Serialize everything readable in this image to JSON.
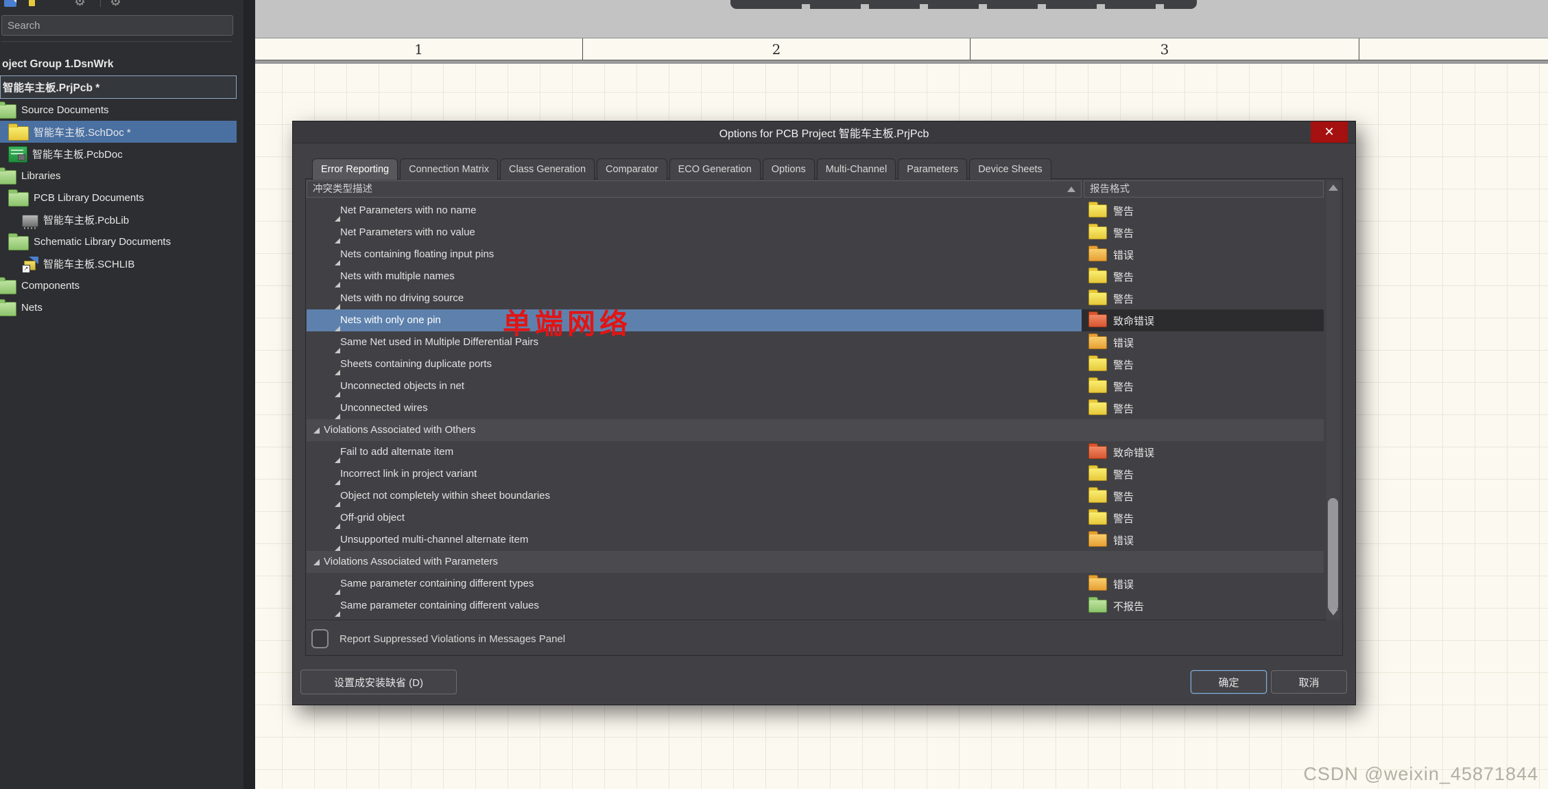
{
  "watermark": "CSDN @weixin_45871844",
  "annotation": {
    "text": "单端网络",
    "color": "#e01515"
  },
  "ruler": {
    "labels": [
      "1",
      "2",
      "3",
      ""
    ]
  },
  "sidebar": {
    "search_placeholder": "Search",
    "tree": [
      {
        "label": "oject Group 1.DsnWrk",
        "indent": 0,
        "flags": [
          "bold"
        ]
      },
      {
        "label": "智能车主板.PrjPcb *",
        "indent": 0,
        "flags": [
          "bold",
          "focused"
        ]
      },
      {
        "label": "Source Documents",
        "icon": "folder-green",
        "indent": 1
      },
      {
        "label": "智能车主板.SchDoc *",
        "icon": "folder-yellow",
        "indent": 2,
        "flags": [
          "selected"
        ]
      },
      {
        "label": "智能车主板.PcbDoc",
        "icon": "pcb-doc",
        "indent": 2
      },
      {
        "label": "Libraries",
        "icon": "folder-green",
        "indent": 1
      },
      {
        "label": "PCB Library Documents",
        "icon": "folder-green",
        "indent": 2
      },
      {
        "label": "智能车主板.PcbLib",
        "icon": "pcb-lib",
        "indent": 3
      },
      {
        "label": "Schematic Library Documents",
        "icon": "folder-green",
        "indent": 2
      },
      {
        "label": "智能车主板.SCHLIB",
        "icon": "sch-lib",
        "indent": 3
      },
      {
        "label": "Components",
        "icon": "folder-green",
        "indent": 1
      },
      {
        "label": "Nets",
        "icon": "folder-green",
        "indent": 1
      }
    ]
  },
  "dialog": {
    "title": "Options for PCB Project 智能车主板.PrjPcb",
    "close_glyph": "✕",
    "tabs": [
      {
        "label": "Error Reporting",
        "flags": [
          "active"
        ]
      },
      {
        "label": "Connection Matrix"
      },
      {
        "label": "Class Generation"
      },
      {
        "label": "Comparator"
      },
      {
        "label": "ECO Generation"
      },
      {
        "label": "Options"
      },
      {
        "label": "Multi-Channel"
      },
      {
        "label": "Parameters"
      },
      {
        "label": "Device Sheets"
      }
    ],
    "grid": {
      "headers": {
        "description": "冲突类型描述",
        "report_mode": "报告格式"
      },
      "severity_colors": {
        "warning": "#e7c83a",
        "error": "#e89f33",
        "fatal": "#d85531",
        "none": "#8cc46c"
      },
      "rows": [
        {
          "label": "Net Parameters with no name",
          "report": "警告",
          "sev": "warning"
        },
        {
          "label": "Net Parameters with no value",
          "report": "警告",
          "sev": "warning"
        },
        {
          "label": "Nets containing floating input pins",
          "report": "错误",
          "sev": "error"
        },
        {
          "label": "Nets with multiple names",
          "report": "警告",
          "sev": "warning"
        },
        {
          "label": "Nets with no driving source",
          "report": "警告",
          "sev": "warning"
        },
        {
          "label": "Nets with only one pin",
          "report": "致命错误",
          "sev": "fatal",
          "flags": [
            "selected"
          ]
        },
        {
          "label": "Same Net used in Multiple Differential Pairs",
          "report": "错误",
          "sev": "error"
        },
        {
          "label": "Sheets containing duplicate ports",
          "report": "警告",
          "sev": "warning"
        },
        {
          "label": "Unconnected objects in net",
          "report": "警告",
          "sev": "warning"
        },
        {
          "label": "Unconnected wires",
          "report": "警告",
          "sev": "warning"
        },
        {
          "label": "Violations Associated with Others",
          "flags": [
            "group"
          ]
        },
        {
          "label": "Fail to add alternate item",
          "report": "致命错误",
          "sev": "fatal"
        },
        {
          "label": "Incorrect link in project variant",
          "report": "警告",
          "sev": "warning"
        },
        {
          "label": "Object not completely within sheet boundaries",
          "report": "警告",
          "sev": "warning"
        },
        {
          "label": "Off-grid object",
          "report": "警告",
          "sev": "warning"
        },
        {
          "label": "Unsupported multi-channel alternate item",
          "report": "错误",
          "sev": "error"
        },
        {
          "label": "Violations Associated with Parameters",
          "flags": [
            "group"
          ]
        },
        {
          "label": "Same parameter containing different types",
          "report": "错误",
          "sev": "error"
        },
        {
          "label": "Same parameter containing different values",
          "report": "不报告",
          "sev": "none"
        }
      ]
    },
    "suppress_checkbox": {
      "label": "Report Suppressed Violations in Messages Panel",
      "checked": false
    },
    "footer": {
      "set_defaults": "设置成安装缺省 (D)",
      "ok": "确定",
      "cancel": "取消"
    }
  }
}
